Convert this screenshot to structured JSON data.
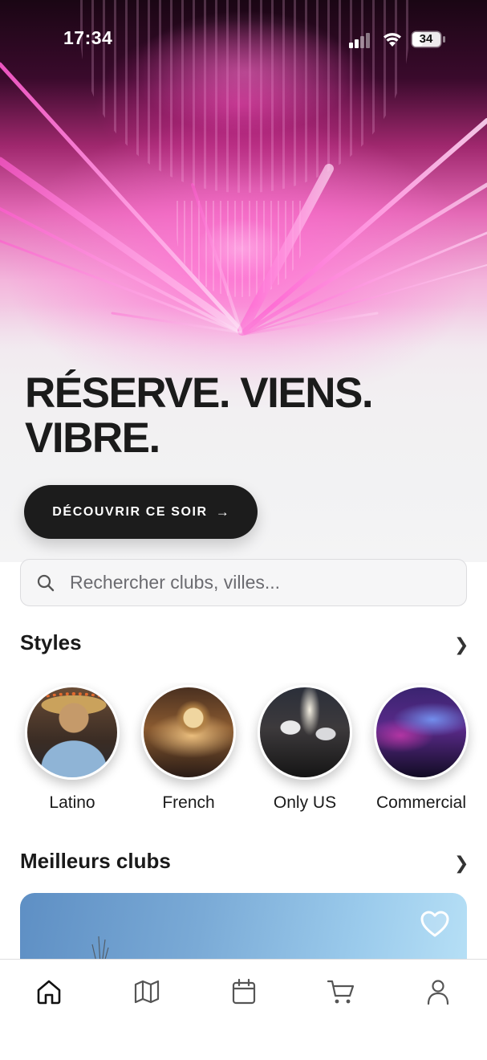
{
  "status_bar": {
    "time": "17:34",
    "battery_level": "34",
    "icons": [
      "signal-icon",
      "wifi-icon",
      "battery-icon"
    ]
  },
  "hero": {
    "headline_line1": "RÉSERVE. VIENS.",
    "headline_line2": "VIBRE.",
    "cta_label": "DÉCOUVRIR CE SOIR",
    "cta_arrow": "→"
  },
  "search": {
    "placeholder": "Rechercher clubs, villes...",
    "value": ""
  },
  "styles_section": {
    "title": "Styles",
    "chevron": "❯",
    "items": [
      {
        "label": "Latino"
      },
      {
        "label": "French"
      },
      {
        "label": "Only US"
      },
      {
        "label": "Commercial"
      }
    ]
  },
  "clubs_section": {
    "title": "Meilleurs clubs",
    "chevron": "❯"
  },
  "tab_bar": {
    "tabs": [
      {
        "icon": "home-icon",
        "active": true
      },
      {
        "icon": "map-icon",
        "active": false
      },
      {
        "icon": "calendar-icon",
        "active": false
      },
      {
        "icon": "cart-icon",
        "active": false
      },
      {
        "icon": "user-icon",
        "active": false
      }
    ]
  },
  "colors": {
    "accent_pink": "#e46ab6",
    "dark_button": "#1c1c1c",
    "text_primary": "#1a1a1a"
  }
}
